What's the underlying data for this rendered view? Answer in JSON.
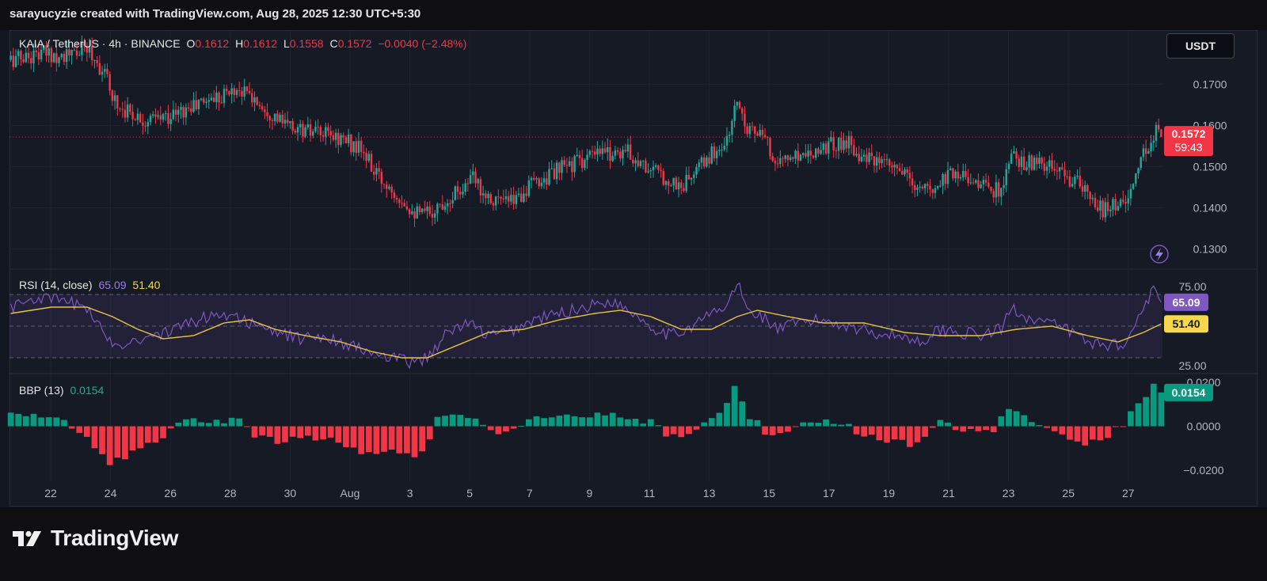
{
  "header": {
    "credit": "sarayucyzie created with TradingView.com, Aug 28, 2025 12:30 UTC+5:30"
  },
  "symbol_legend": {
    "symbol": "KAIA / TetherUS · 4h · BINANCE",
    "o_label": "O",
    "o_value": "0.1612",
    "h_label": "H",
    "h_value": "0.1612",
    "l_label": "L",
    "l_value": "0.1558",
    "c_label": "C",
    "c_value": "0.1572",
    "change": "−0.0040 (−2.48%)"
  },
  "currency_button": "USDT",
  "logo_text": "TradingView",
  "colors": {
    "background": "#161a25",
    "up": "#26a69a",
    "down": "#f23645",
    "rsi_line": "#7e57c2",
    "rsi_ma": "#e8c341",
    "bbp_up": "#089981",
    "bbp_down": "#f23645"
  },
  "chart_data": [
    {
      "type": "candlestick",
      "title": "KAIA / TetherUS · 4h · BINANCE",
      "ylim": [
        0.1255,
        0.183
      ],
      "y_ticks": [
        "0.1700",
        "0.1600",
        "0.1500",
        "0.1400",
        "0.1300"
      ],
      "x_ticks": [
        "22",
        "24",
        "26",
        "28",
        "30",
        "Aug",
        "3",
        "5",
        "7",
        "9",
        "11",
        "13",
        "15",
        "17",
        "19",
        "21",
        "23",
        "25",
        "27"
      ],
      "last_price": "0.1572",
      "countdown": "59:43",
      "close_path": [
        [
          0,
          0.176
        ],
        [
          12,
          0.1775
        ],
        [
          24,
          0.177
        ],
        [
          30,
          0.179
        ],
        [
          36,
          0.1735
        ],
        [
          42,
          0.165
        ],
        [
          54,
          0.161
        ],
        [
          66,
          0.163
        ],
        [
          78,
          0.1665
        ],
        [
          90,
          0.169
        ],
        [
          99,
          0.165
        ],
        [
          108,
          0.16
        ],
        [
          120,
          0.158
        ],
        [
          130,
          0.157
        ],
        [
          138,
          0.154
        ],
        [
          145,
          0.147
        ],
        [
          150,
          0.145
        ],
        [
          156,
          0.141
        ],
        [
          161,
          0.138
        ],
        [
          168,
          0.14
        ],
        [
          175,
          0.144
        ],
        [
          182,
          0.147
        ],
        [
          188,
          0.143
        ],
        [
          196,
          0.141
        ],
        [
          204,
          0.145
        ],
        [
          212,
          0.148
        ],
        [
          222,
          0.151
        ],
        [
          232,
          0.153
        ],
        [
          242,
          0.154
        ],
        [
          250,
          0.15
        ],
        [
          258,
          0.147
        ],
        [
          264,
          0.145
        ],
        [
          270,
          0.149
        ],
        [
          276,
          0.153
        ],
        [
          282,
          0.156
        ],
        [
          286,
          0.166
        ],
        [
          290,
          0.16
        ],
        [
          296,
          0.157
        ],
        [
          302,
          0.151
        ],
        [
          310,
          0.153
        ],
        [
          320,
          0.155
        ],
        [
          330,
          0.156
        ],
        [
          336,
          0.152
        ],
        [
          344,
          0.15
        ],
        [
          350,
          0.149
        ],
        [
          356,
          0.145
        ],
        [
          362,
          0.144
        ],
        [
          370,
          0.149
        ],
        [
          376,
          0.148
        ],
        [
          384,
          0.145
        ],
        [
          390,
          0.144
        ],
        [
          394,
          0.152
        ],
        [
          400,
          0.151
        ],
        [
          408,
          0.15
        ],
        [
          414,
          0.148
        ],
        [
          420,
          0.146
        ],
        [
          426,
          0.141
        ],
        [
          430,
          0.1395
        ],
        [
          436,
          0.141
        ],
        [
          442,
          0.144
        ],
        [
          445,
          0.152
        ],
        [
          448,
          0.154
        ],
        [
          451,
          0.16
        ],
        [
          453,
          0.1572
        ]
      ]
    },
    {
      "type": "line",
      "title": "RSI (14, close)",
      "rsi_value": "65.09",
      "ma_value": "51.40",
      "ylim": [
        20,
        83
      ],
      "y_ticks": [
        "75.00",
        "25.00"
      ],
      "band": [
        30,
        70
      ],
      "midline": 50,
      "rsi_path": [
        [
          0,
          62
        ],
        [
          10,
          68
        ],
        [
          20,
          66
        ],
        [
          30,
          62
        ],
        [
          36,
          46
        ],
        [
          42,
          38
        ],
        [
          50,
          42
        ],
        [
          56,
          44
        ],
        [
          62,
          46
        ],
        [
          70,
          52
        ],
        [
          78,
          56
        ],
        [
          86,
          58
        ],
        [
          92,
          54
        ],
        [
          98,
          48
        ],
        [
          106,
          46
        ],
        [
          114,
          42
        ],
        [
          122,
          44
        ],
        [
          130,
          40
        ],
        [
          140,
          34
        ],
        [
          148,
          30
        ],
        [
          156,
          28
        ],
        [
          160,
          26
        ],
        [
          166,
          34
        ],
        [
          172,
          46
        ],
        [
          180,
          52
        ],
        [
          188,
          44
        ],
        [
          196,
          46
        ],
        [
          206,
          54
        ],
        [
          216,
          58
        ],
        [
          226,
          62
        ],
        [
          236,
          66
        ],
        [
          244,
          60
        ],
        [
          252,
          50
        ],
        [
          260,
          44
        ],
        [
          268,
          50
        ],
        [
          276,
          58
        ],
        [
          282,
          62
        ],
        [
          286,
          78
        ],
        [
          290,
          60
        ],
        [
          296,
          56
        ],
        [
          302,
          48
        ],
        [
          310,
          52
        ],
        [
          320,
          54
        ],
        [
          330,
          50
        ],
        [
          340,
          46
        ],
        [
          350,
          44
        ],
        [
          358,
          40
        ],
        [
          366,
          48
        ],
        [
          374,
          46
        ],
        [
          382,
          44
        ],
        [
          390,
          48
        ],
        [
          394,
          62
        ],
        [
          400,
          56
        ],
        [
          408,
          52
        ],
        [
          416,
          48
        ],
        [
          424,
          40
        ],
        [
          432,
          38
        ],
        [
          440,
          40
        ],
        [
          446,
          64
        ],
        [
          450,
          72
        ],
        [
          453,
          65
        ]
      ],
      "ma_path": [
        [
          0,
          58
        ],
        [
          16,
          62
        ],
        [
          30,
          62
        ],
        [
          40,
          56
        ],
        [
          50,
          48
        ],
        [
          60,
          42
        ],
        [
          72,
          44
        ],
        [
          84,
          52
        ],
        [
          94,
          54
        ],
        [
          104,
          48
        ],
        [
          116,
          44
        ],
        [
          130,
          40
        ],
        [
          142,
          34
        ],
        [
          154,
          30
        ],
        [
          164,
          30
        ],
        [
          176,
          38
        ],
        [
          188,
          46
        ],
        [
          202,
          48
        ],
        [
          216,
          54
        ],
        [
          230,
          58
        ],
        [
          240,
          60
        ],
        [
          252,
          56
        ],
        [
          264,
          48
        ],
        [
          276,
          48
        ],
        [
          286,
          56
        ],
        [
          294,
          60
        ],
        [
          306,
          56
        ],
        [
          320,
          52
        ],
        [
          336,
          52
        ],
        [
          352,
          46
        ],
        [
          366,
          44
        ],
        [
          382,
          44
        ],
        [
          396,
          48
        ],
        [
          410,
          50
        ],
        [
          424,
          44
        ],
        [
          436,
          40
        ],
        [
          446,
          46
        ],
        [
          453,
          51.4
        ]
      ]
    },
    {
      "type": "bar",
      "title": "BBP (13)",
      "last_value": "0.0154",
      "ylim": [
        -0.024,
        0.024
      ],
      "y_ticks": [
        "0.0200",
        "0.0000",
        "−0.0200"
      ],
      "bbp_path": [
        [
          0,
          0.007
        ],
        [
          10,
          0.005
        ],
        [
          20,
          0.003
        ],
        [
          24,
          -0.001
        ],
        [
          30,
          -0.004
        ],
        [
          36,
          -0.014
        ],
        [
          40,
          -0.017
        ],
        [
          46,
          -0.013
        ],
        [
          54,
          -0.008
        ],
        [
          60,
          -0.004
        ],
        [
          66,
          0.003
        ],
        [
          76,
          0.002
        ],
        [
          86,
          0.003
        ],
        [
          92,
          0.003
        ],
        [
          96,
          -0.004
        ],
        [
          104,
          -0.007
        ],
        [
          112,
          -0.006
        ],
        [
          120,
          -0.005
        ],
        [
          128,
          -0.006
        ],
        [
          136,
          -0.011
        ],
        [
          144,
          -0.012
        ],
        [
          152,
          -0.011
        ],
        [
          158,
          -0.014
        ],
        [
          164,
          -0.008
        ],
        [
          168,
          0.003
        ],
        [
          176,
          0.006
        ],
        [
          182,
          0.004
        ],
        [
          188,
          -0.003
        ],
        [
          196,
          -0.003
        ],
        [
          206,
          0.003
        ],
        [
          216,
          0.004
        ],
        [
          226,
          0.005
        ],
        [
          236,
          0.005
        ],
        [
          244,
          0.003
        ],
        [
          252,
          0.002
        ],
        [
          258,
          -0.004
        ],
        [
          266,
          -0.005
        ],
        [
          272,
          0.002
        ],
        [
          278,
          0.005
        ],
        [
          282,
          0.01
        ],
        [
          286,
          0.022
        ],
        [
          289,
          0.005
        ],
        [
          294,
          0.003
        ],
        [
          298,
          -0.005
        ],
        [
          304,
          -0.004
        ],
        [
          310,
          0.001
        ],
        [
          320,
          0.003
        ],
        [
          328,
          0.002
        ],
        [
          334,
          -0.004
        ],
        [
          340,
          -0.005
        ],
        [
          348,
          -0.007
        ],
        [
          354,
          -0.008
        ],
        [
          360,
          -0.005
        ],
        [
          366,
          0.003
        ],
        [
          372,
          -0.001
        ],
        [
          380,
          -0.002
        ],
        [
          388,
          -0.003
        ],
        [
          392,
          0.01
        ],
        [
          398,
          0.005
        ],
        [
          404,
          0.002
        ],
        [
          410,
          -0.001
        ],
        [
          416,
          -0.006
        ],
        [
          424,
          -0.008
        ],
        [
          432,
          -0.004
        ],
        [
          438,
          0.001
        ],
        [
          442,
          0.008
        ],
        [
          448,
          0.016
        ],
        [
          452,
          0.02
        ],
        [
          453,
          0.0154
        ]
      ]
    }
  ]
}
